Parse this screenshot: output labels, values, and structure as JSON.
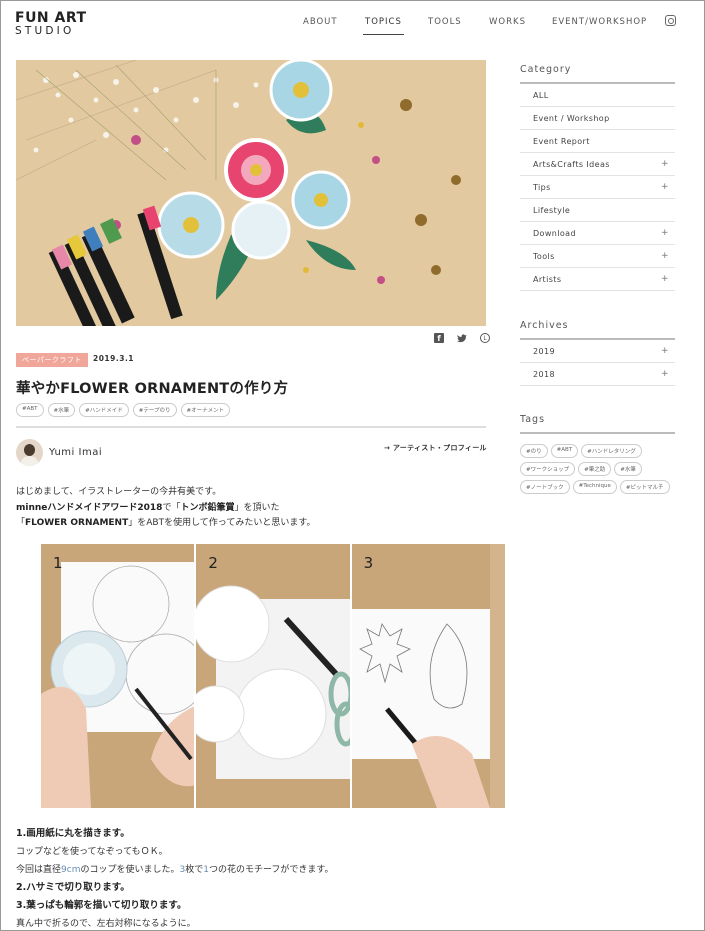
{
  "header": {
    "logo_line1": "FUN ART",
    "logo_line2": "STUDIO",
    "nav": [
      "ABOUT",
      "TOPICS",
      "TOOLS",
      "WORKS",
      "EVENT/WORKSHOP"
    ],
    "active_nav": "TOPICS",
    "social_icon": "instagram-icon"
  },
  "article": {
    "share_icons": [
      "facebook-icon",
      "twitter-icon",
      "line-icon"
    ],
    "category": "ペーパークラフト",
    "date": "2019.3.1",
    "title": "華やかFLOWER ORNAMENTの作り方",
    "tags": [
      "#ABT",
      "#水筆",
      "#ハンドメイド",
      "#テープのり",
      "#オーナメント"
    ],
    "author": {
      "name": "Yumi Imai",
      "profile_link": "→ アーティスト・プロフィール"
    },
    "intro": {
      "line1": "はじめまして、イラストレーターの今井有美です。",
      "line2_a": "minneハンドメイドアワード2018",
      "line2_b": "で「",
      "line2_c": "トンボ鉛筆賞",
      "line2_d": "」を頂いた",
      "line3_a": "「",
      "line3_b": "FLOWER ORNAMENT",
      "line3_c": "」をABTを使用して作ってみたいと思います。"
    },
    "step_panels": [
      "1",
      "2",
      "3"
    ],
    "steps": {
      "s1_title": "1.画用紙に丸を描きます。",
      "s1_line1": "コップなどを使ってなぞってもＯＫ。",
      "s1_line2_a": "今回は直径",
      "s1_line2_b": "9cm",
      "s1_line2_c": "のコップを使いました。",
      "s1_line2_d": "3",
      "s1_line2_e": "枚で",
      "s1_line2_f": "1",
      "s1_line2_g": "つの花のモチーフができます。",
      "s2_title": "2.ハサミで切り取ります。",
      "s3_title": "3.葉っぱも輪郭を描いて切り取ります。",
      "s3_line1": "真ん中で折るので、左右対称になるように。"
    }
  },
  "sidebar": {
    "category_heading": "Category",
    "categories": [
      {
        "label": "ALL",
        "expandable": false
      },
      {
        "label": "Event / Workshop",
        "expandable": false
      },
      {
        "label": "Event Report",
        "expandable": false
      },
      {
        "label": "Arts&Crafts Ideas",
        "expandable": true
      },
      {
        "label": "Tips",
        "expandable": true
      },
      {
        "label": "Lifestyle",
        "expandable": false
      },
      {
        "label": "Download",
        "expandable": true
      },
      {
        "label": "Tools",
        "expandable": true
      },
      {
        "label": "Artists",
        "expandable": true
      }
    ],
    "archives_heading": "Archives",
    "archives": [
      {
        "label": "2019",
        "expandable": true
      },
      {
        "label": "2018",
        "expandable": true
      }
    ],
    "tags_heading": "Tags",
    "tags": [
      "#のり",
      "#ABT",
      "#ハンドレタリング",
      "#ワークショップ",
      "#筆之助",
      "#水筆",
      "#ノートブック",
      "#Technique",
      "#ピットマルチ"
    ],
    "plus_symbol": "+"
  }
}
